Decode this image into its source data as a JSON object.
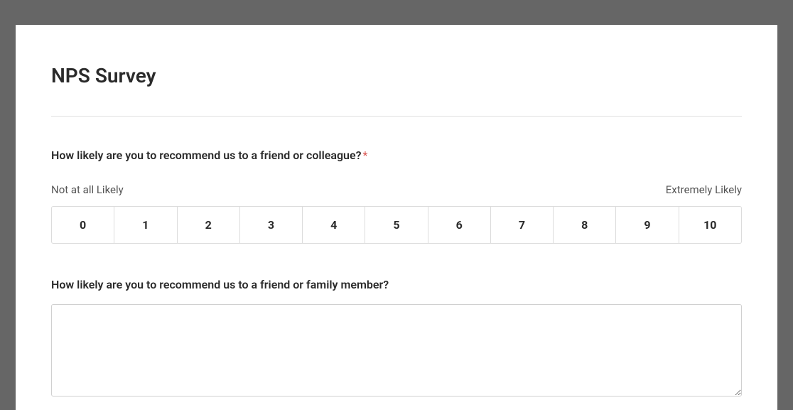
{
  "title": "NPS Survey",
  "question1": {
    "text": "How likely are you to recommend us to a friend or colleague?",
    "required_marker": "*",
    "min_label": "Not at all Likely",
    "max_label": "Extremely Likely",
    "options": [
      "0",
      "1",
      "2",
      "3",
      "4",
      "5",
      "6",
      "7",
      "8",
      "9",
      "10"
    ]
  },
  "question2": {
    "text": "How likely are you to recommend us to a friend or family member?",
    "value": ""
  }
}
